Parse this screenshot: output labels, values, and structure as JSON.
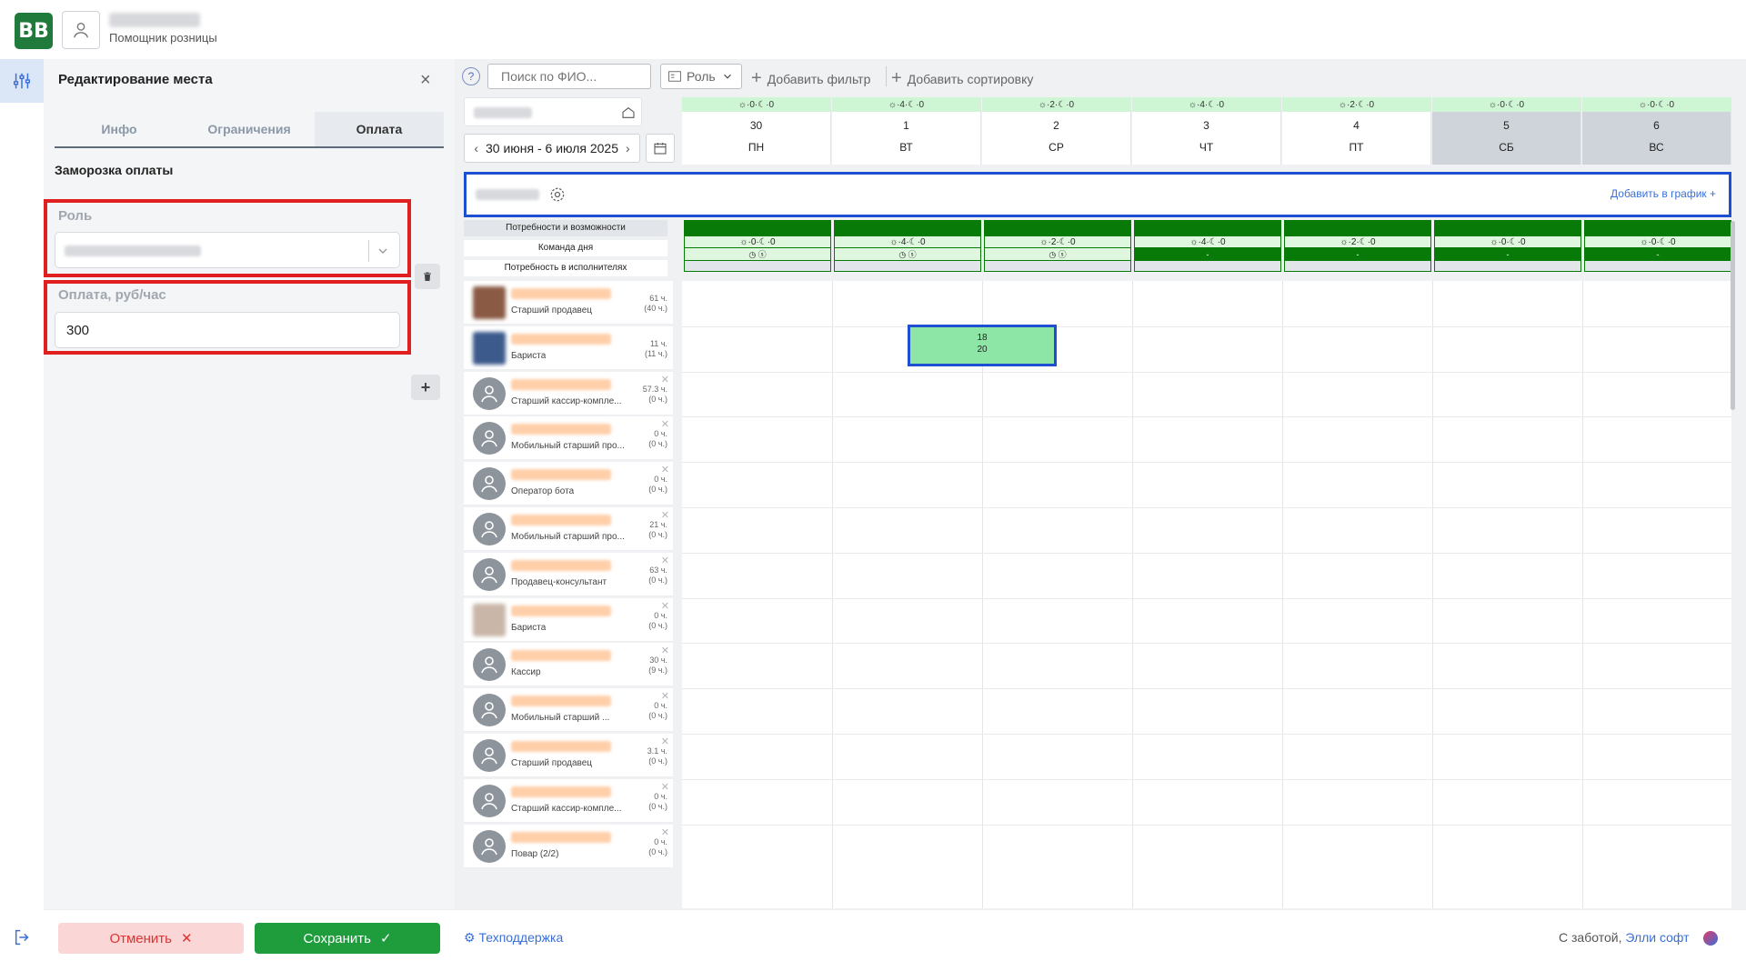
{
  "header": {
    "logo_text": "BB",
    "user_role": "Помощник розницы"
  },
  "panel": {
    "title": "Редактирование места",
    "tabs": [
      {
        "label": "Инфо",
        "active": false
      },
      {
        "label": "Ограничения",
        "active": false
      },
      {
        "label": "Оплата",
        "active": true
      }
    ],
    "section_label": "Заморозка оплаты",
    "role_label": "Роль",
    "pay_label": "Оплата, руб/час",
    "pay_value": "300",
    "cancel_label": "Отменить",
    "save_label": "Сохранить"
  },
  "footer": {
    "support_label": "Техподдержка",
    "credit_prefix": "С заботой,",
    "credit_brand": "Элли софт"
  },
  "toolbar": {
    "search_placeholder": "Поиск по ФИО...",
    "role_filter": "Роль",
    "add_filter": "Добавить фильтр",
    "add_sort": "Добавить сортировку"
  },
  "schedule": {
    "date_range": "30 июня - 6 июля 2025",
    "add_to_schedule": "Добавить в график",
    "row_labels": [
      "Потребности и возможности",
      "Команда дня",
      "Потребность в исполнителях"
    ],
    "days": [
      {
        "num": "30",
        "name": "ПН",
        "weather": "☼·0·☾·0",
        "weekend": false,
        "need": "☼·0·☾·0"
      },
      {
        "num": "1",
        "name": "ВТ",
        "weather": "☼·4·☾·0",
        "weekend": false,
        "need": "☼·4·☾·0"
      },
      {
        "num": "2",
        "name": "СР",
        "weather": "☼·2·☾·0",
        "weekend": false,
        "need": "☼·2·☾·0"
      },
      {
        "num": "3",
        "name": "ЧТ",
        "weather": "☼·4·☾·0",
        "weekend": false,
        "need": "☼·4·☾·0"
      },
      {
        "num": "4",
        "name": "ПТ",
        "weather": "☼·2·☾·0",
        "weekend": false,
        "need": "☼·2·☾·0"
      },
      {
        "num": "5",
        "name": "СБ",
        "weather": "☼·0·☾·0",
        "weekend": true,
        "need": "☼·0·☾·0"
      },
      {
        "num": "6",
        "name": "ВС",
        "weather": "☼·0·☾·0",
        "weekend": true,
        "need": "☼·0·☾·0"
      }
    ],
    "employees": [
      {
        "role": "Старший продавец",
        "hours": "61 ч.",
        "hours_sub": "(40 ч.)",
        "photo": true,
        "photo_color": "#8a5a44"
      },
      {
        "role": "Бариста",
        "hours": "11 ч.",
        "hours_sub": "(11 ч.)",
        "photo": true,
        "photo_color": "#3c5a8c"
      },
      {
        "role": "Старший кассир-компле...",
        "hours": "57.3 ч.",
        "hours_sub": "(0 ч.)",
        "photo": false
      },
      {
        "role": "Мобильный старший про...",
        "hours": "0 ч.",
        "hours_sub": "(0 ч.)",
        "photo": false
      },
      {
        "role": "Оператор бота",
        "hours": "0 ч.",
        "hours_sub": "(0 ч.)",
        "photo": false
      },
      {
        "role": "Мобильный старший про...",
        "hours": "21 ч.",
        "hours_sub": "(0 ч.)",
        "photo": false
      },
      {
        "role": "Продавец-консультант",
        "hours": "63 ч.",
        "hours_sub": "(0 ч.)",
        "photo": false
      },
      {
        "role": "Бариста",
        "hours": "0 ч.",
        "hours_sub": "(0 ч.)",
        "photo": true,
        "photo_color": "#c9b6a8"
      },
      {
        "role": "Кассир",
        "hours": "30 ч.",
        "hours_sub": "(9 ч.)",
        "photo": false
      },
      {
        "role": "Мобильный старший ...",
        "hours": "0 ч.",
        "hours_sub": "(0 ч.)",
        "photo": false
      },
      {
        "role": "Старший продавец",
        "hours": "3.1 ч.",
        "hours_sub": "(0 ч.)",
        "photo": false
      },
      {
        "role": "Старший кассир-компле...",
        "hours": "0 ч.",
        "hours_sub": "(0 ч.)",
        "photo": false
      },
      {
        "role": "Повар (2/2)",
        "hours": "0 ч.",
        "hours_sub": "(0 ч.)",
        "photo": false
      }
    ],
    "shift": {
      "line1": "18",
      "line2": "20"
    }
  }
}
